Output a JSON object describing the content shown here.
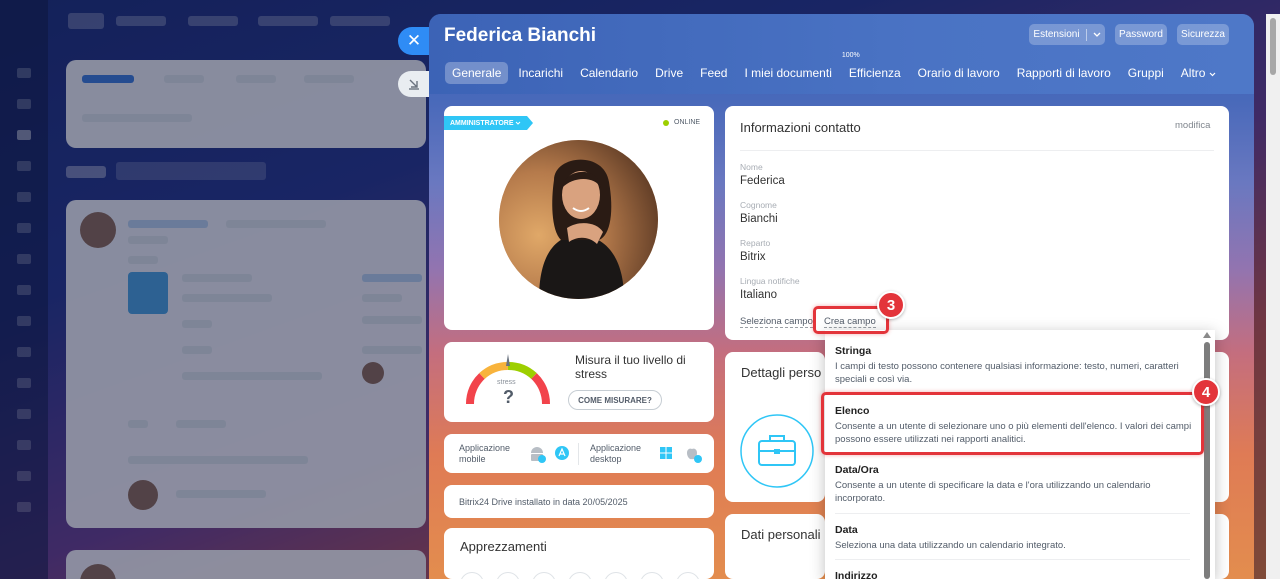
{
  "panel": {
    "user_name": "Federica Bianchi",
    "header_buttons": {
      "extensions": "Estensioni",
      "password": "Password",
      "security": "Sicurezza"
    },
    "tabs": [
      {
        "label": "Generale",
        "active": true
      },
      {
        "label": "Incarichi"
      },
      {
        "label": "Calendario"
      },
      {
        "label": "Drive"
      },
      {
        "label": "Feed"
      },
      {
        "label": "I miei documenti"
      },
      {
        "label": "Efficienza",
        "sup": "100%"
      },
      {
        "label": "Orario di lavoro"
      },
      {
        "label": "Rapporti di lavoro"
      },
      {
        "label": "Gruppi"
      },
      {
        "label": "Altro"
      }
    ]
  },
  "profile": {
    "role_badge": "AMMINISTRATORE",
    "status": "ONLINE",
    "status_color": "#9dcf00"
  },
  "stress": {
    "title": "Misura il tuo livello di stress",
    "gauge_label": "stress",
    "gauge_value": "?",
    "button": "COME MISURARE?"
  },
  "apps": {
    "mobile": "Applicazione mobile",
    "desktop": "Applicazione desktop"
  },
  "drive_note": "Bitrix24 Drive installato in data 20/05/2025",
  "appreciations": {
    "title": "Apprezzamenti"
  },
  "contact": {
    "title": "Informazioni contatto",
    "edit": "modifica",
    "fields": [
      {
        "label": "Nome",
        "value": "Federica"
      },
      {
        "label": "Cognome",
        "value": "Bianchi"
      },
      {
        "label": "Reparto",
        "value": "Bitrix"
      },
      {
        "label": "Lingua notifiche",
        "value": "Italiano"
      }
    ],
    "select_field": "Seleziona campo",
    "create_field": "Crea campo"
  },
  "sections": {
    "personal_details": "Dettagli perso",
    "personal_data": "Dati personali"
  },
  "dropdown": {
    "items": [
      {
        "title": "Stringa",
        "desc": "I campi di testo possono contenere qualsiasi informazione: testo, numeri, caratteri speciali e così via."
      },
      {
        "title": "Elenco",
        "desc": "Consente a un utente di selezionare uno o più elementi dell'elenco. I valori dei campi possono essere utilizzati nei rapporti analitici."
      },
      {
        "title": "Data/Ora",
        "desc": "Consente a un utente di specificare la data e l'ora utilizzando un calendario incorporato."
      },
      {
        "title": "Data",
        "desc": "Seleziona una data utilizzando un calendario integrato."
      },
      {
        "title": "Indirizzo",
        "desc": ""
      }
    ]
  },
  "annotations": {
    "step3": "3",
    "step4": "4",
    "color": "#e3343a"
  }
}
